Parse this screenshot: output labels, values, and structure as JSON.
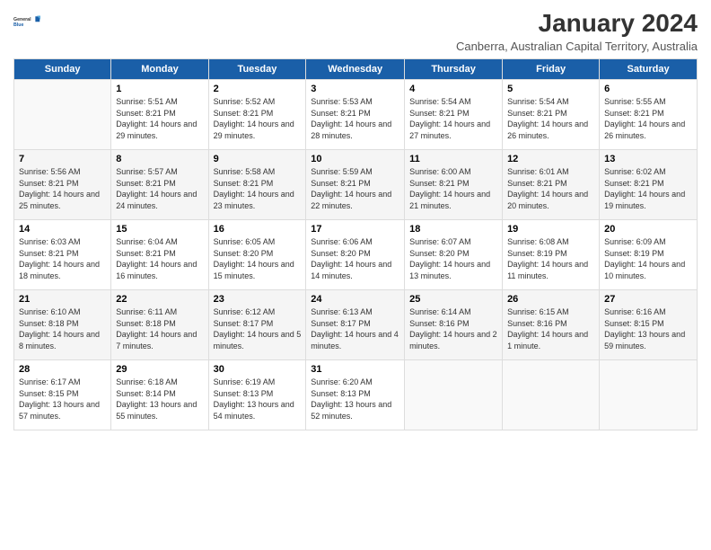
{
  "logo": {
    "line1": "General",
    "line2": "Blue"
  },
  "title": "January 2024",
  "subtitle": "Canberra, Australian Capital Territory, Australia",
  "days_of_week": [
    "Sunday",
    "Monday",
    "Tuesday",
    "Wednesday",
    "Thursday",
    "Friday",
    "Saturday"
  ],
  "weeks": [
    [
      {
        "day": "",
        "info": ""
      },
      {
        "day": "1",
        "info": "Sunrise: 5:51 AM\nSunset: 8:21 PM\nDaylight: 14 hours\nand 29 minutes."
      },
      {
        "day": "2",
        "info": "Sunrise: 5:52 AM\nSunset: 8:21 PM\nDaylight: 14 hours\nand 29 minutes."
      },
      {
        "day": "3",
        "info": "Sunrise: 5:53 AM\nSunset: 8:21 PM\nDaylight: 14 hours\nand 28 minutes."
      },
      {
        "day": "4",
        "info": "Sunrise: 5:54 AM\nSunset: 8:21 PM\nDaylight: 14 hours\nand 27 minutes."
      },
      {
        "day": "5",
        "info": "Sunrise: 5:54 AM\nSunset: 8:21 PM\nDaylight: 14 hours\nand 26 minutes."
      },
      {
        "day": "6",
        "info": "Sunrise: 5:55 AM\nSunset: 8:21 PM\nDaylight: 14 hours\nand 26 minutes."
      }
    ],
    [
      {
        "day": "7",
        "info": "Sunrise: 5:56 AM\nSunset: 8:21 PM\nDaylight: 14 hours\nand 25 minutes."
      },
      {
        "day": "8",
        "info": "Sunrise: 5:57 AM\nSunset: 8:21 PM\nDaylight: 14 hours\nand 24 minutes."
      },
      {
        "day": "9",
        "info": "Sunrise: 5:58 AM\nSunset: 8:21 PM\nDaylight: 14 hours\nand 23 minutes."
      },
      {
        "day": "10",
        "info": "Sunrise: 5:59 AM\nSunset: 8:21 PM\nDaylight: 14 hours\nand 22 minutes."
      },
      {
        "day": "11",
        "info": "Sunrise: 6:00 AM\nSunset: 8:21 PM\nDaylight: 14 hours\nand 21 minutes."
      },
      {
        "day": "12",
        "info": "Sunrise: 6:01 AM\nSunset: 8:21 PM\nDaylight: 14 hours\nand 20 minutes."
      },
      {
        "day": "13",
        "info": "Sunrise: 6:02 AM\nSunset: 8:21 PM\nDaylight: 14 hours\nand 19 minutes."
      }
    ],
    [
      {
        "day": "14",
        "info": "Sunrise: 6:03 AM\nSunset: 8:21 PM\nDaylight: 14 hours\nand 18 minutes."
      },
      {
        "day": "15",
        "info": "Sunrise: 6:04 AM\nSunset: 8:21 PM\nDaylight: 14 hours\nand 16 minutes."
      },
      {
        "day": "16",
        "info": "Sunrise: 6:05 AM\nSunset: 8:20 PM\nDaylight: 14 hours\nand 15 minutes."
      },
      {
        "day": "17",
        "info": "Sunrise: 6:06 AM\nSunset: 8:20 PM\nDaylight: 14 hours\nand 14 minutes."
      },
      {
        "day": "18",
        "info": "Sunrise: 6:07 AM\nSunset: 8:20 PM\nDaylight: 14 hours\nand 13 minutes."
      },
      {
        "day": "19",
        "info": "Sunrise: 6:08 AM\nSunset: 8:19 PM\nDaylight: 14 hours\nand 11 minutes."
      },
      {
        "day": "20",
        "info": "Sunrise: 6:09 AM\nSunset: 8:19 PM\nDaylight: 14 hours\nand 10 minutes."
      }
    ],
    [
      {
        "day": "21",
        "info": "Sunrise: 6:10 AM\nSunset: 8:18 PM\nDaylight: 14 hours\nand 8 minutes."
      },
      {
        "day": "22",
        "info": "Sunrise: 6:11 AM\nSunset: 8:18 PM\nDaylight: 14 hours\nand 7 minutes."
      },
      {
        "day": "23",
        "info": "Sunrise: 6:12 AM\nSunset: 8:17 PM\nDaylight: 14 hours\nand 5 minutes."
      },
      {
        "day": "24",
        "info": "Sunrise: 6:13 AM\nSunset: 8:17 PM\nDaylight: 14 hours\nand 4 minutes."
      },
      {
        "day": "25",
        "info": "Sunrise: 6:14 AM\nSunset: 8:16 PM\nDaylight: 14 hours\nand 2 minutes."
      },
      {
        "day": "26",
        "info": "Sunrise: 6:15 AM\nSunset: 8:16 PM\nDaylight: 14 hours\nand 1 minute."
      },
      {
        "day": "27",
        "info": "Sunrise: 6:16 AM\nSunset: 8:15 PM\nDaylight: 13 hours\nand 59 minutes."
      }
    ],
    [
      {
        "day": "28",
        "info": "Sunrise: 6:17 AM\nSunset: 8:15 PM\nDaylight: 13 hours\nand 57 minutes."
      },
      {
        "day": "29",
        "info": "Sunrise: 6:18 AM\nSunset: 8:14 PM\nDaylight: 13 hours\nand 55 minutes."
      },
      {
        "day": "30",
        "info": "Sunrise: 6:19 AM\nSunset: 8:13 PM\nDaylight: 13 hours\nand 54 minutes."
      },
      {
        "day": "31",
        "info": "Sunrise: 6:20 AM\nSunset: 8:13 PM\nDaylight: 13 hours\nand 52 minutes."
      },
      {
        "day": "",
        "info": ""
      },
      {
        "day": "",
        "info": ""
      },
      {
        "day": "",
        "info": ""
      }
    ]
  ]
}
